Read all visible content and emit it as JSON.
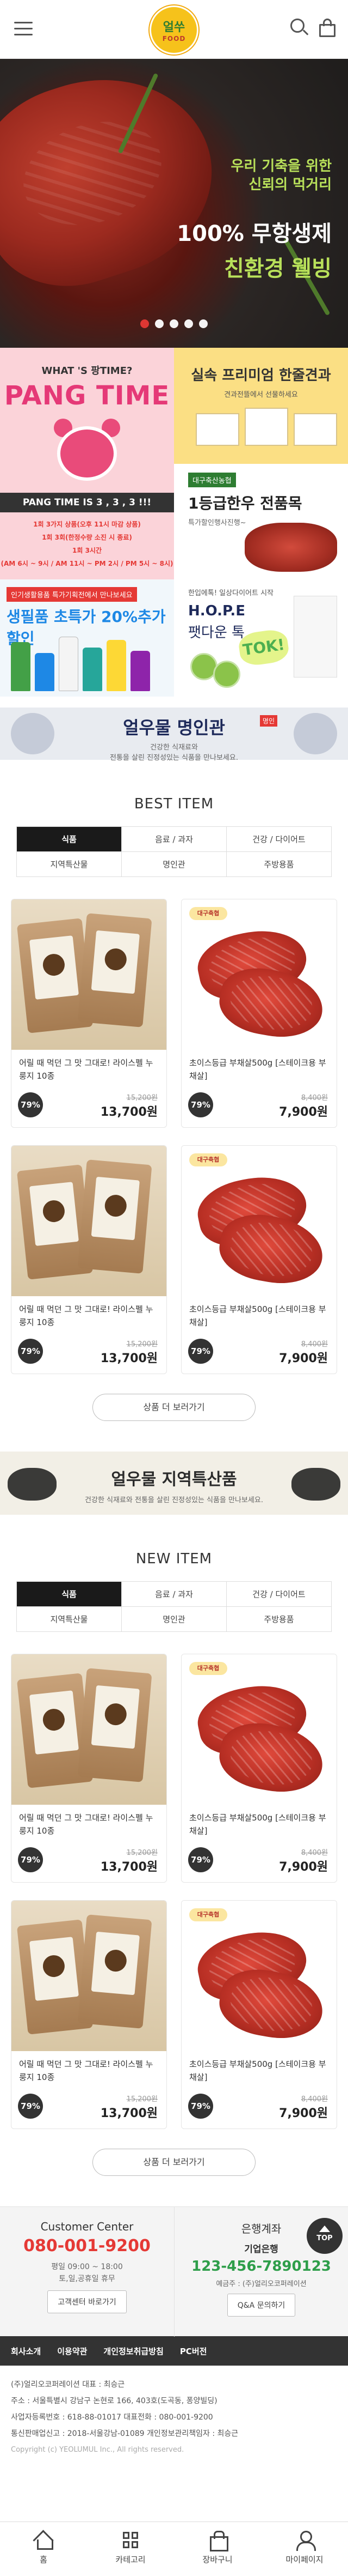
{
  "header": {
    "logo_line1": "얼쑤",
    "logo_line2": "FOOD"
  },
  "hero": {
    "line1": "우리 기축을 위한",
    "line2": "신뢰의 먹거리",
    "line3": "100% 무항생제",
    "line4": "친환경 웰빙",
    "slides": 5,
    "active_slide": 1
  },
  "promo": {
    "pang_what": "WHAT 'S 팡TIME?",
    "pang_title": "PANG TIME",
    "pang_bar": "PANG TIME IS 3 , 3 , 3 !!!",
    "pang_info1": "1회 3가지 상품(오후 11시 마감 상품)",
    "pang_info2": "1회 3회(한정수량 소진 시 종료)",
    "pang_info3": "1회 3시간",
    "pang_info4": "(AM 6시 ~ 9시 / AM 11시 ~ PM 2시 / PM 5시 ~ 8시)",
    "premium_title": "실속 프리미엄 한줄견과",
    "premium_sub": "견과전뜰에서 선물하세요",
    "meat_badge": "대구축산농협",
    "meat_title": "1등급한우 전품목",
    "meat_sub": "특가할인행사진행~",
    "season_badge": "인기생활용품 특가기획전에서 만나보세요",
    "season_title": "생필품 초특가 20%추가할인",
    "hope_t0": "한입에톡! 일상다이어트 시작",
    "hope_t1": "H.O.P.E",
    "hope_t2": "팻다운 톡",
    "hope_tok": "TOK!"
  },
  "banner_master": {
    "title": "얼우물 명인관",
    "sub1": "건강한 식재료와",
    "sub2": "전통을 살린 진정성있는 식품을 만나보세요.",
    "ribbon": "명인"
  },
  "best": {
    "title": "BEST ITEM",
    "tabs": [
      "식품",
      "음료 / 과자",
      "건강 / 다이어트",
      "지역특산물",
      "명인관",
      "주방용품"
    ],
    "items": [
      {
        "name": "어릴 때 먹던 그 맛 그대로! 라이스펠 누룽지 10종",
        "discount": "79%",
        "original": "15,200원",
        "price": "13,700원",
        "type": "rice"
      },
      {
        "name": "초이스등급 부채살500g [스테이크용 부채살]",
        "discount": "79%",
        "original": "8,400원",
        "price": "7,900원",
        "type": "beef"
      },
      {
        "name": "어릴 때 먹던 그 맛 그대로! 라이스펠 누룽지 10종",
        "discount": "79%",
        "original": "15,200원",
        "price": "13,700원",
        "type": "rice"
      },
      {
        "name": "초이스등급 부채살500g [스테이크용 부채살]",
        "discount": "79%",
        "original": "8,400원",
        "price": "7,900원",
        "type": "beef"
      }
    ],
    "more_label": "상품 더 보러가기"
  },
  "banner_region": {
    "title": "얼우물 지역특산품",
    "sub": "건강한 식재료와 전통을 살린 진정성있는 식품을 만나보세요."
  },
  "new": {
    "title": "NEW ITEM",
    "tabs": [
      "식품",
      "음료 / 과자",
      "건강 / 다이어트",
      "지역특산물",
      "명인관",
      "주방용품"
    ],
    "items": [
      {
        "name": "어릴 때 먹던 그 맛 그대로! 라이스펠 누룽지 10종",
        "discount": "79%",
        "original": "15,200원",
        "price": "13,700원",
        "type": "rice"
      },
      {
        "name": "초이스등급 부채살500g [스테이크용 부채살]",
        "discount": "79%",
        "original": "8,400원",
        "price": "7,900원",
        "type": "beef"
      },
      {
        "name": "어릴 때 먹던 그 맛 그대로! 라이스펠 누룽지 10종",
        "discount": "79%",
        "original": "15,200원",
        "price": "13,700원",
        "type": "rice"
      },
      {
        "name": "초이스등급 부채살500g [스테이크용 부채살]",
        "discount": "79%",
        "original": "8,400원",
        "price": "7,900원",
        "type": "beef"
      }
    ],
    "more_label": "상품 더 보러가기"
  },
  "beef_logo": "대구축협",
  "cs": {
    "title": "Customer Center",
    "phone": "080-001-9200",
    "hours1": "평일 09:00 ~ 18:00",
    "hours2": "토,일,공휴일 휴무",
    "btn": "고객센터 바로가기",
    "bank_title": "은행계좌",
    "bank_name": "기업은행",
    "account": "123-456-7890123",
    "holder": "예금주 : (주)얼리오코퍼레이션",
    "qa_btn": "Q&A 문의하기",
    "top_label": "TOP"
  },
  "footer": {
    "nav": [
      "회사소개",
      "이용약관",
      "개인정보취급방침",
      "PC버전"
    ],
    "line1": "(주)얼리오코퍼레이션     대표 : 최승근",
    "line2": "주소 : 서울특별시 강남구 논현로 166, 403호(도곡동, 퐁양빌딩)",
    "line3": "사업자등록번호 : 618-88-01017      대표전화 : 080-001-9200",
    "line4": "통신판매업신고 : 2018-서울강남-01089      개인정보관리책임자 : 최승근",
    "copyright": "Copyright (c) YEOLUMUL Inc., All rights reserved."
  },
  "bottom_bar": {
    "home": "홈",
    "category": "카테고리",
    "cart": "장바구니",
    "mypage": "마이페이지"
  }
}
